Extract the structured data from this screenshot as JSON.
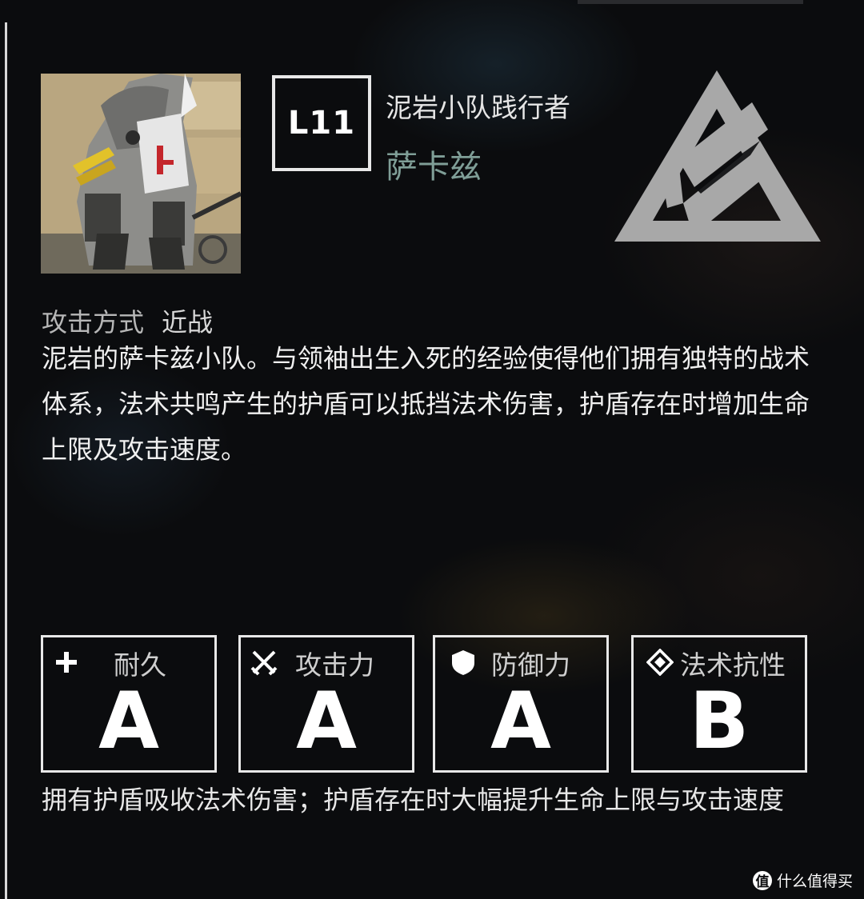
{
  "unit": {
    "level": "L11",
    "subtitle": "泥岩小队践行者",
    "name": "萨卡兹",
    "name_color": "#7f9e97"
  },
  "attack_mode": {
    "label": "攻击方式",
    "value": "近战"
  },
  "description": "泥岩的萨卡兹小队。与领袖出生入死的经验使得他们拥有独特的战术体系，法术共鸣产生的护盾可以抵挡法术伤害，护盾存在时增加生命上限及攻击速度。",
  "stats": [
    {
      "label": "耐久",
      "grade": "A",
      "icon": "plus-icon"
    },
    {
      "label": "攻击力",
      "grade": "A",
      "icon": "crossed-swords-icon"
    },
    {
      "label": "防御力",
      "grade": "A",
      "icon": "shield-icon"
    },
    {
      "label": "法术抗性",
      "grade": "B",
      "icon": "diamond-icon"
    }
  ],
  "trait": "拥有护盾吸收法术伤害；护盾存在时大幅提升生命上限与攻击速度",
  "watermark": {
    "logo_text": "值",
    "text": "什么值得买"
  },
  "colors": {
    "background": "#0b0c0e",
    "border": "#e8e8e8",
    "emblem": "#a8a8a8"
  }
}
